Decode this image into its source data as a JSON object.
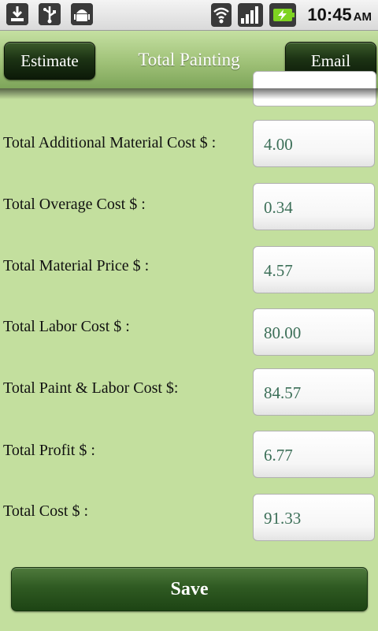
{
  "status_bar": {
    "left_icons": [
      "download-icon",
      "usb-icon",
      "android-debug-icon"
    ],
    "right_icons": [
      "wifi-icon",
      "signal-icon",
      "battery-charging-icon"
    ],
    "time": "10:45",
    "ampm": "AM"
  },
  "header": {
    "estimate_label": "Estimate",
    "title": "Total Painting",
    "email_label": "Email"
  },
  "rows": [
    {
      "label": "Total Additional Material Cost $ :",
      "value": "4.00"
    },
    {
      "label": "Total Overage Cost $ :",
      "value": "0.34"
    },
    {
      "label": "Total Material Price $ :",
      "value": "4.57"
    },
    {
      "label": "Total Labor Cost $ :",
      "value": "80.00"
    },
    {
      "label": "Total Paint & Labor Cost $:",
      "value": "84.57"
    },
    {
      "label": "Total Profit $ :",
      "value": "6.77"
    },
    {
      "label": "Total Cost $ :",
      "value": "91.33"
    }
  ],
  "save_label": "Save",
  "colors": {
    "background": "#c3df9e",
    "header_button": "#1c3314",
    "value_text": "#3c6f58",
    "save_button": "#2f5a22"
  }
}
